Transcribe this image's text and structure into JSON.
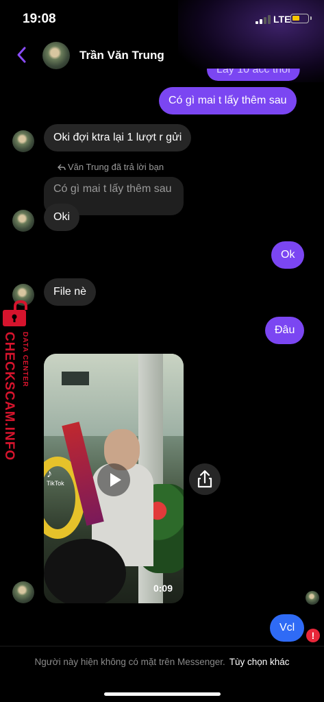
{
  "status_bar": {
    "time": "19:08",
    "network": "LTE"
  },
  "header": {
    "contact_name": "Trần Văn Trung"
  },
  "messages": {
    "out_partial": "Lấy 10 acc thôi",
    "out_1": "Có gì mai t lấy thêm sau",
    "in_1": "Oki đợi ktra lại 1 lượt r gửi",
    "reply_note": "Văn Trung đã trả lời bạn",
    "quoted": "Có gì mai t lấy thêm sau",
    "in_2": "Oki",
    "out_2": "Ok",
    "in_3": "File nè",
    "out_3": "Đâu",
    "out_4": "Vcl"
  },
  "video": {
    "duration": "0:09",
    "brand": "TikTok"
  },
  "watermark": {
    "title": "CHECKSCAM.INFO",
    "subtitle": "DATA CENTER"
  },
  "error_badge": "!",
  "footer": {
    "info": "Người này hiện không có mặt trên Messenger.",
    "link": "Tùy chọn khác"
  }
}
